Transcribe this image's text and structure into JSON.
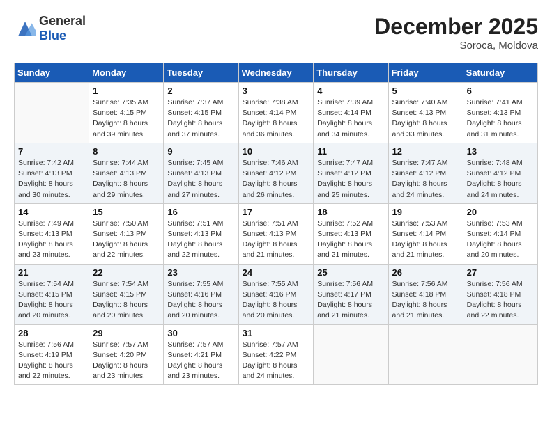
{
  "header": {
    "logo_general": "General",
    "logo_blue": "Blue",
    "month_title": "December 2025",
    "location": "Soroca, Moldova"
  },
  "days_of_week": [
    "Sunday",
    "Monday",
    "Tuesday",
    "Wednesday",
    "Thursday",
    "Friday",
    "Saturday"
  ],
  "weeks": [
    [
      {
        "day": "",
        "info": ""
      },
      {
        "day": "1",
        "info": "Sunrise: 7:35 AM\nSunset: 4:15 PM\nDaylight: 8 hours\nand 39 minutes."
      },
      {
        "day": "2",
        "info": "Sunrise: 7:37 AM\nSunset: 4:15 PM\nDaylight: 8 hours\nand 37 minutes."
      },
      {
        "day": "3",
        "info": "Sunrise: 7:38 AM\nSunset: 4:14 PM\nDaylight: 8 hours\nand 36 minutes."
      },
      {
        "day": "4",
        "info": "Sunrise: 7:39 AM\nSunset: 4:14 PM\nDaylight: 8 hours\nand 34 minutes."
      },
      {
        "day": "5",
        "info": "Sunrise: 7:40 AM\nSunset: 4:13 PM\nDaylight: 8 hours\nand 33 minutes."
      },
      {
        "day": "6",
        "info": "Sunrise: 7:41 AM\nSunset: 4:13 PM\nDaylight: 8 hours\nand 31 minutes."
      }
    ],
    [
      {
        "day": "7",
        "info": "Sunrise: 7:42 AM\nSunset: 4:13 PM\nDaylight: 8 hours\nand 30 minutes."
      },
      {
        "day": "8",
        "info": "Sunrise: 7:44 AM\nSunset: 4:13 PM\nDaylight: 8 hours\nand 29 minutes."
      },
      {
        "day": "9",
        "info": "Sunrise: 7:45 AM\nSunset: 4:13 PM\nDaylight: 8 hours\nand 27 minutes."
      },
      {
        "day": "10",
        "info": "Sunrise: 7:46 AM\nSunset: 4:12 PM\nDaylight: 8 hours\nand 26 minutes."
      },
      {
        "day": "11",
        "info": "Sunrise: 7:47 AM\nSunset: 4:12 PM\nDaylight: 8 hours\nand 25 minutes."
      },
      {
        "day": "12",
        "info": "Sunrise: 7:47 AM\nSunset: 4:12 PM\nDaylight: 8 hours\nand 24 minutes."
      },
      {
        "day": "13",
        "info": "Sunrise: 7:48 AM\nSunset: 4:12 PM\nDaylight: 8 hours\nand 24 minutes."
      }
    ],
    [
      {
        "day": "14",
        "info": "Sunrise: 7:49 AM\nSunset: 4:13 PM\nDaylight: 8 hours\nand 23 minutes."
      },
      {
        "day": "15",
        "info": "Sunrise: 7:50 AM\nSunset: 4:13 PM\nDaylight: 8 hours\nand 22 minutes."
      },
      {
        "day": "16",
        "info": "Sunrise: 7:51 AM\nSunset: 4:13 PM\nDaylight: 8 hours\nand 22 minutes."
      },
      {
        "day": "17",
        "info": "Sunrise: 7:51 AM\nSunset: 4:13 PM\nDaylight: 8 hours\nand 21 minutes."
      },
      {
        "day": "18",
        "info": "Sunrise: 7:52 AM\nSunset: 4:13 PM\nDaylight: 8 hours\nand 21 minutes."
      },
      {
        "day": "19",
        "info": "Sunrise: 7:53 AM\nSunset: 4:14 PM\nDaylight: 8 hours\nand 21 minutes."
      },
      {
        "day": "20",
        "info": "Sunrise: 7:53 AM\nSunset: 4:14 PM\nDaylight: 8 hours\nand 20 minutes."
      }
    ],
    [
      {
        "day": "21",
        "info": "Sunrise: 7:54 AM\nSunset: 4:15 PM\nDaylight: 8 hours\nand 20 minutes."
      },
      {
        "day": "22",
        "info": "Sunrise: 7:54 AM\nSunset: 4:15 PM\nDaylight: 8 hours\nand 20 minutes."
      },
      {
        "day": "23",
        "info": "Sunrise: 7:55 AM\nSunset: 4:16 PM\nDaylight: 8 hours\nand 20 minutes."
      },
      {
        "day": "24",
        "info": "Sunrise: 7:55 AM\nSunset: 4:16 PM\nDaylight: 8 hours\nand 20 minutes."
      },
      {
        "day": "25",
        "info": "Sunrise: 7:56 AM\nSunset: 4:17 PM\nDaylight: 8 hours\nand 21 minutes."
      },
      {
        "day": "26",
        "info": "Sunrise: 7:56 AM\nSunset: 4:18 PM\nDaylight: 8 hours\nand 21 minutes."
      },
      {
        "day": "27",
        "info": "Sunrise: 7:56 AM\nSunset: 4:18 PM\nDaylight: 8 hours\nand 22 minutes."
      }
    ],
    [
      {
        "day": "28",
        "info": "Sunrise: 7:56 AM\nSunset: 4:19 PM\nDaylight: 8 hours\nand 22 minutes."
      },
      {
        "day": "29",
        "info": "Sunrise: 7:57 AM\nSunset: 4:20 PM\nDaylight: 8 hours\nand 23 minutes."
      },
      {
        "day": "30",
        "info": "Sunrise: 7:57 AM\nSunset: 4:21 PM\nDaylight: 8 hours\nand 23 minutes."
      },
      {
        "day": "31",
        "info": "Sunrise: 7:57 AM\nSunset: 4:22 PM\nDaylight: 8 hours\nand 24 minutes."
      },
      {
        "day": "",
        "info": ""
      },
      {
        "day": "",
        "info": ""
      },
      {
        "day": "",
        "info": ""
      }
    ]
  ]
}
